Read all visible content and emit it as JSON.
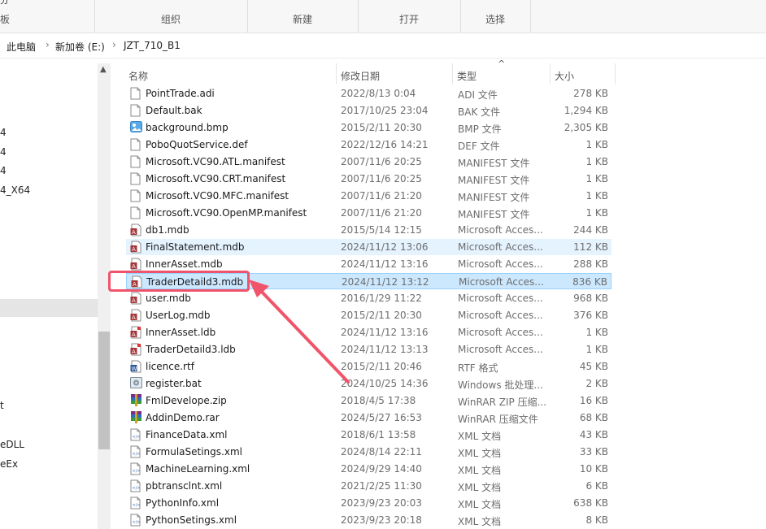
{
  "ribbon": {
    "groups": [
      {
        "label": "组织"
      },
      {
        "label": "新建"
      },
      {
        "label": "打开"
      },
      {
        "label": "选择"
      }
    ],
    "cut_text_top": "分",
    "cut_text_left": "板"
  },
  "address": {
    "crumbs": [
      "此电脑",
      "新加卷 (E:)",
      "JZT_710_B1"
    ],
    "separator": "›"
  },
  "nav": {
    "items": [
      "4",
      "4",
      "4",
      "4_X64",
      "t",
      "eDLL",
      "eEx"
    ]
  },
  "columns": {
    "name": "名称",
    "date": "修改日期",
    "type": "类型",
    "size": "大小",
    "sort_indicator": "^"
  },
  "files": [
    {
      "name": "PointTrade.adi",
      "date": "2022/8/13 0:04",
      "type": "ADI 文件",
      "size": "278 KB",
      "icon": "file-icon"
    },
    {
      "name": "Default.bak",
      "date": "2017/10/25 23:04",
      "type": "BAK 文件",
      "size": "1,294 KB",
      "icon": "file-icon"
    },
    {
      "name": "background.bmp",
      "date": "2015/2/11 20:30",
      "type": "BMP 文件",
      "size": "2,305 KB",
      "icon": "image-icon"
    },
    {
      "name": "PoboQuotService.def",
      "date": "2022/12/16 14:21",
      "type": "DEF 文件",
      "size": "1 KB",
      "icon": "file-icon"
    },
    {
      "name": "Microsoft.VC90.ATL.manifest",
      "date": "2007/11/6 20:25",
      "type": "MANIFEST 文件",
      "size": "1 KB",
      "icon": "file-icon"
    },
    {
      "name": "Microsoft.VC90.CRT.manifest",
      "date": "2007/11/6 20:25",
      "type": "MANIFEST 文件",
      "size": "1 KB",
      "icon": "file-icon"
    },
    {
      "name": "Microsoft.VC90.MFC.manifest",
      "date": "2007/11/6 21:20",
      "type": "MANIFEST 文件",
      "size": "1 KB",
      "icon": "file-icon"
    },
    {
      "name": "Microsoft.VC90.OpenMP.manifest",
      "date": "2007/11/6 21:20",
      "type": "MANIFEST 文件",
      "size": "1 KB",
      "icon": "file-icon"
    },
    {
      "name": "db1.mdb",
      "date": "2015/5/14 12:15",
      "type": "Microsoft Acces...",
      "size": "244 KB",
      "icon": "access-icon"
    },
    {
      "name": "FinalStatement.mdb",
      "date": "2024/11/12 13:06",
      "type": "Microsoft Acces...",
      "size": "112 KB",
      "icon": "access-icon"
    },
    {
      "name": "InnerAsset.mdb",
      "date": "2024/11/12 13:16",
      "type": "Microsoft Acces...",
      "size": "288 KB",
      "icon": "access-icon"
    },
    {
      "name": "TraderDetaild3.mdb",
      "date": "2024/11/12 13:12",
      "type": "Microsoft Acces...",
      "size": "836 KB",
      "icon": "access-icon"
    },
    {
      "name": "user.mdb",
      "date": "2016/1/29 11:22",
      "type": "Microsoft Acces...",
      "size": "968 KB",
      "icon": "access-icon"
    },
    {
      "name": "UserLog.mdb",
      "date": "2015/2/11 20:30",
      "type": "Microsoft Acces...",
      "size": "376 KB",
      "icon": "access-icon"
    },
    {
      "name": "InnerAsset.ldb",
      "date": "2024/11/12 13:16",
      "type": "Microsoft Acces...",
      "size": "1 KB",
      "icon": "access-lock-icon"
    },
    {
      "name": "TraderDetaild3.ldb",
      "date": "2024/11/12 13:13",
      "type": "Microsoft Acces...",
      "size": "1 KB",
      "icon": "access-lock-icon"
    },
    {
      "name": "licence.rtf",
      "date": "2015/2/11 20:46",
      "type": "RTF 格式",
      "size": "45 KB",
      "icon": "word-icon"
    },
    {
      "name": "register.bat",
      "date": "2024/10/25 14:36",
      "type": "Windows 批处理...",
      "size": "2 KB",
      "icon": "batch-icon"
    },
    {
      "name": "FmlDevelope.zip",
      "date": "2018/4/5 17:38",
      "type": "WinRAR ZIP 压缩...",
      "size": "16 KB",
      "icon": "winrar-icon"
    },
    {
      "name": "AddinDemo.rar",
      "date": "2024/5/27 16:53",
      "type": "WinRAR 压缩文件",
      "size": "68 KB",
      "icon": "winrar-icon"
    },
    {
      "name": "FinanceData.xml",
      "date": "2018/6/1 13:58",
      "type": "XML 文档",
      "size": "43 KB",
      "icon": "xml-icon"
    },
    {
      "name": "FormulaSetings.xml",
      "date": "2024/8/14 22:11",
      "type": "XML 文档",
      "size": "33 KB",
      "icon": "xml-icon"
    },
    {
      "name": "MachineLearning.xml",
      "date": "2024/9/29 14:40",
      "type": "XML 文档",
      "size": "10 KB",
      "icon": "xml-icon"
    },
    {
      "name": "pbtransclnt.xml",
      "date": "2021/2/25 11:30",
      "type": "XML 文档",
      "size": "6 KB",
      "icon": "xml-icon"
    },
    {
      "name": "PythonInfo.xml",
      "date": "2023/9/23 20:03",
      "type": "XML 文档",
      "size": "638 KB",
      "icon": "xml-icon"
    },
    {
      "name": "PythonSetings.xml",
      "date": "2023/9/23 20:18",
      "type": "XML 文档",
      "size": "8 KB",
      "icon": "xml-icon"
    }
  ],
  "selected_index": 11,
  "hover_index": 9,
  "colors": {
    "annotation": "#f0546a",
    "selection": "#cce8ff",
    "hover": "#e5f3ff"
  }
}
